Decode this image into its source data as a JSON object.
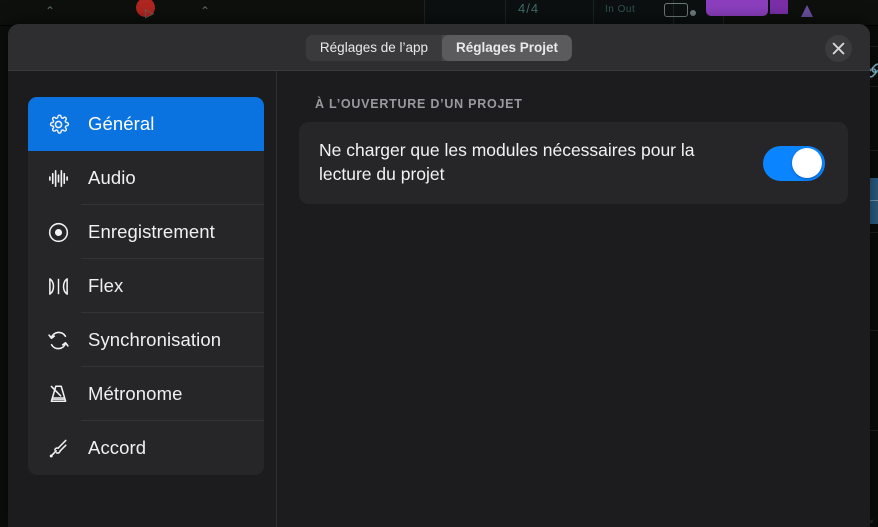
{
  "background": {
    "lcd_signature": "4/4",
    "lcd_io": "In  Out",
    "corner_glyph": "⤡"
  },
  "modal": {
    "tabs": [
      {
        "label": "Réglages de l’app",
        "active": false,
        "name": "tab-app-settings"
      },
      {
        "label": "Réglages Projet",
        "active": true,
        "name": "tab-project-settings"
      }
    ],
    "close_label": "✕",
    "accent_color": "#0a73e0",
    "toggle_on_color": "#0a84ff"
  },
  "sidebar": {
    "items": [
      {
        "label": "Général",
        "icon": "gear-icon",
        "selected": true
      },
      {
        "label": "Audio",
        "icon": "waveform-icon",
        "selected": false
      },
      {
        "label": "Enregistrement",
        "icon": "record-icon",
        "selected": false
      },
      {
        "label": "Flex",
        "icon": "flex-icon",
        "selected": false
      },
      {
        "label": "Synchronisation",
        "icon": "sync-icon",
        "selected": false
      },
      {
        "label": "Métronome",
        "icon": "metronome-icon",
        "selected": false
      },
      {
        "label": "Accord",
        "icon": "tuning-fork-icon",
        "selected": false
      }
    ]
  },
  "content": {
    "section_title": "À L’OUVERTURE D’UN PROJET",
    "settings": [
      {
        "label": "Ne charger que les modules nécessaires pour la lecture du projet",
        "toggle_on": true
      }
    ]
  }
}
